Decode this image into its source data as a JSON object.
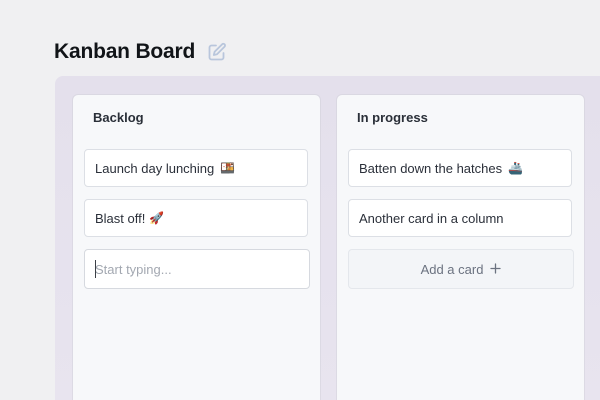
{
  "board": {
    "title": "Kanban Board",
    "edit_icon": "edit-pencil-icon"
  },
  "columns": [
    {
      "title": "Backlog",
      "cards": [
        {
          "text": "Launch day lunching",
          "emoji": "🍱"
        },
        {
          "text": "Blast off!",
          "emoji": "🚀"
        }
      ],
      "new_card": {
        "value": "",
        "placeholder": "Start typing..."
      }
    },
    {
      "title": "In progress",
      "cards": [
        {
          "text": "Batten down the hatches",
          "emoji": "🚢"
        },
        {
          "text": "Another card in a column",
          "emoji": ""
        }
      ],
      "add_card": {
        "label": "Add a card",
        "icon": "plus-icon"
      }
    }
  ],
  "colors": {
    "background": "#f0f0f2",
    "board_area": "#e6e2ee",
    "column": "#f7f8fa",
    "card": "#ffffff",
    "muted_text": "#6b7280"
  }
}
